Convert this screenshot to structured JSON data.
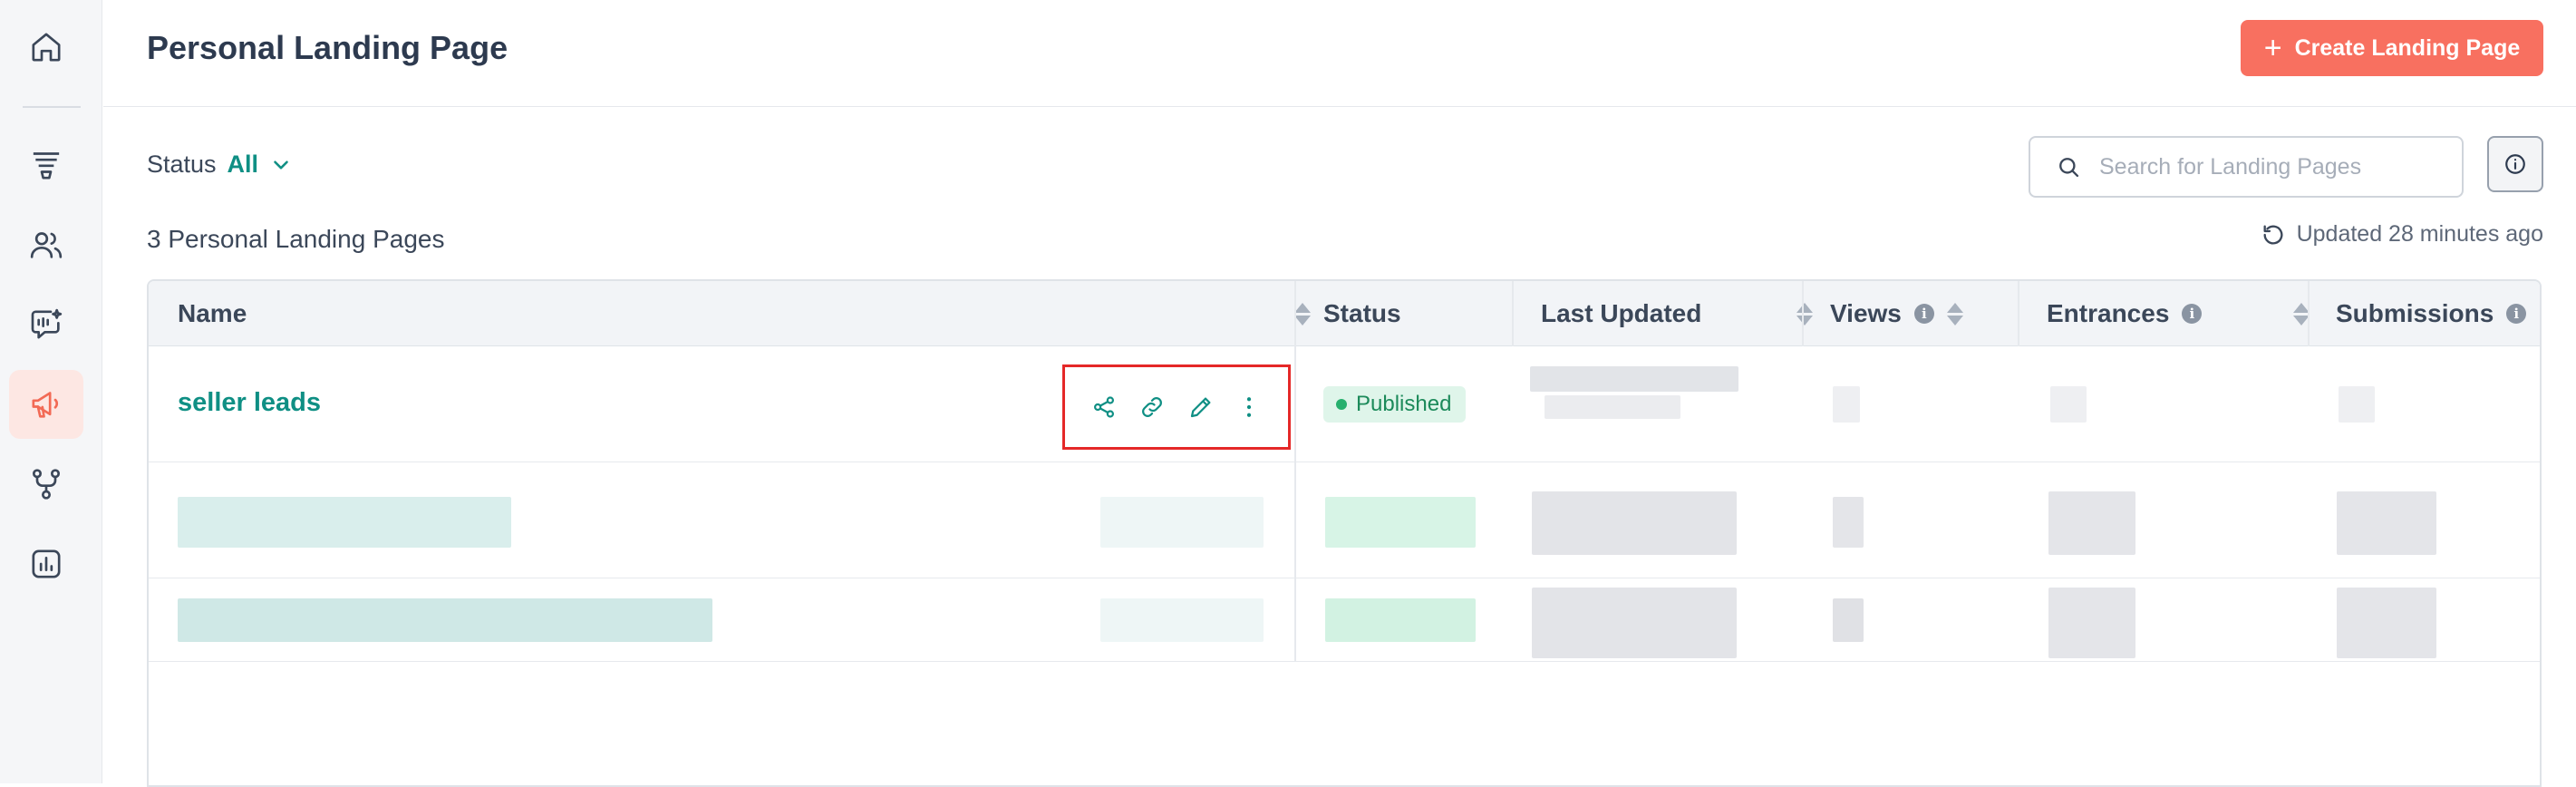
{
  "sidebar": {
    "items": [
      {
        "icon": "home-icon"
      },
      {
        "icon": "funnel-icon"
      },
      {
        "icon": "users-icon"
      },
      {
        "icon": "ai-chat-icon"
      },
      {
        "icon": "megaphone-icon",
        "active": true
      },
      {
        "icon": "branch-icon"
      },
      {
        "icon": "chart-icon"
      }
    ]
  },
  "header": {
    "title": "Personal Landing Page",
    "create_button": "Create Landing Page"
  },
  "filters": {
    "status_label": "Status",
    "status_value": "All"
  },
  "search": {
    "placeholder": "Search for Landing Pages"
  },
  "summary": {
    "count_label": "3 Personal Landing Pages",
    "updated_label": "Updated 28 minutes ago"
  },
  "table": {
    "columns": [
      "Name",
      "Status",
      "Last Updated",
      "Views",
      "Entrances",
      "Submissions"
    ],
    "rows": [
      {
        "name": "seller leads",
        "status": "Published"
      }
    ]
  },
  "colors": {
    "accent": "#0f8f84",
    "primary_button": "#f87060",
    "highlight_box": "#e52828",
    "published_bg": "#dff5ea"
  }
}
